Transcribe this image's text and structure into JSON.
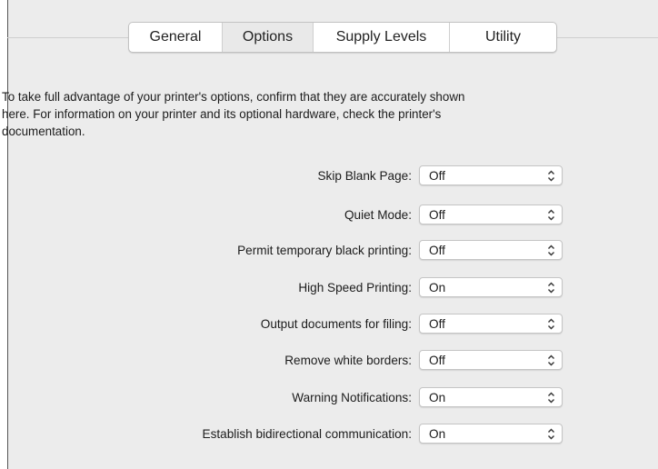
{
  "tabs": [
    {
      "label": "General"
    },
    {
      "label": "Options",
      "selected": true
    },
    {
      "label": "Supply Levels"
    },
    {
      "label": "Utility"
    }
  ],
  "description": {
    "line1": "To take full advantage of your printer's options, confirm that they are accurately shown",
    "line2": "here. For information on your printer and its optional hardware, check the printer's",
    "line3": "documentation."
  },
  "options": [
    {
      "label": "Skip Blank Page:",
      "value": "Off"
    },
    {
      "label": "Quiet Mode:",
      "value": "Off"
    },
    {
      "label": "Permit temporary black printing:",
      "value": "Off"
    },
    {
      "label": "High Speed Printing:",
      "value": "On"
    },
    {
      "label": "Output documents for filing:",
      "value": "Off"
    },
    {
      "label": "Remove white borders:",
      "value": "Off"
    },
    {
      "label": "Warning Notifications:",
      "value": "On"
    },
    {
      "label": "Establish bidirectional communication:",
      "value": "On"
    }
  ],
  "icons": {
    "select_chevron": "up-down-chevron-icon"
  },
  "colors": {
    "panel_background": "#ececec",
    "control_background": "#ffffff"
  }
}
